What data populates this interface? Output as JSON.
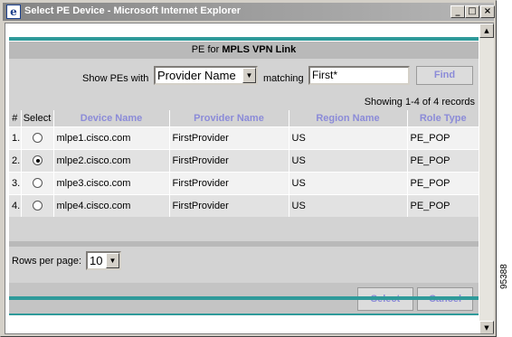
{
  "window": {
    "title": "Select PE Device - Microsoft Internet Explorer",
    "icon": "ie-icon",
    "controls": {
      "minimize": "_",
      "maximize": "□",
      "close": "×"
    }
  },
  "header": {
    "prefix": "PE for",
    "emphasis": "MPLS VPN Link"
  },
  "filter": {
    "show_label": "Show PEs with",
    "field_selected": "Provider Name",
    "matching_label": "matching",
    "match_value": "First*",
    "find_label": "Find"
  },
  "records_text": "Showing 1-4 of 4 records",
  "table": {
    "columns": [
      "#",
      "Select",
      "Device Name",
      "Provider Name",
      "Region Name",
      "Role Type"
    ],
    "rows": [
      {
        "num": "1.",
        "selected": false,
        "device": "mlpe1.cisco.com",
        "provider": "FirstProvider",
        "region": "US",
        "role": "PE_POP"
      },
      {
        "num": "2.",
        "selected": true,
        "device": "mlpe2.cisco.com",
        "provider": "FirstProvider",
        "region": "US",
        "role": "PE_POP"
      },
      {
        "num": "3.",
        "selected": false,
        "device": "mlpe3.cisco.com",
        "provider": "FirstProvider",
        "region": "US",
        "role": "PE_POP"
      },
      {
        "num": "4.",
        "selected": false,
        "device": "mlpe4.cisco.com",
        "provider": "FirstProvider",
        "region": "US",
        "role": "PE_POP"
      }
    ]
  },
  "paging": {
    "rows_label": "Rows per page:",
    "rows_value": "10"
  },
  "footer": {
    "select_label": "Select",
    "cancel_label": "Cancel"
  },
  "figure_id": "95388",
  "colors": {
    "accent_teal": "#2f9a9a",
    "header_link": "#8b8bd8",
    "panel": "#d3d3d3"
  }
}
